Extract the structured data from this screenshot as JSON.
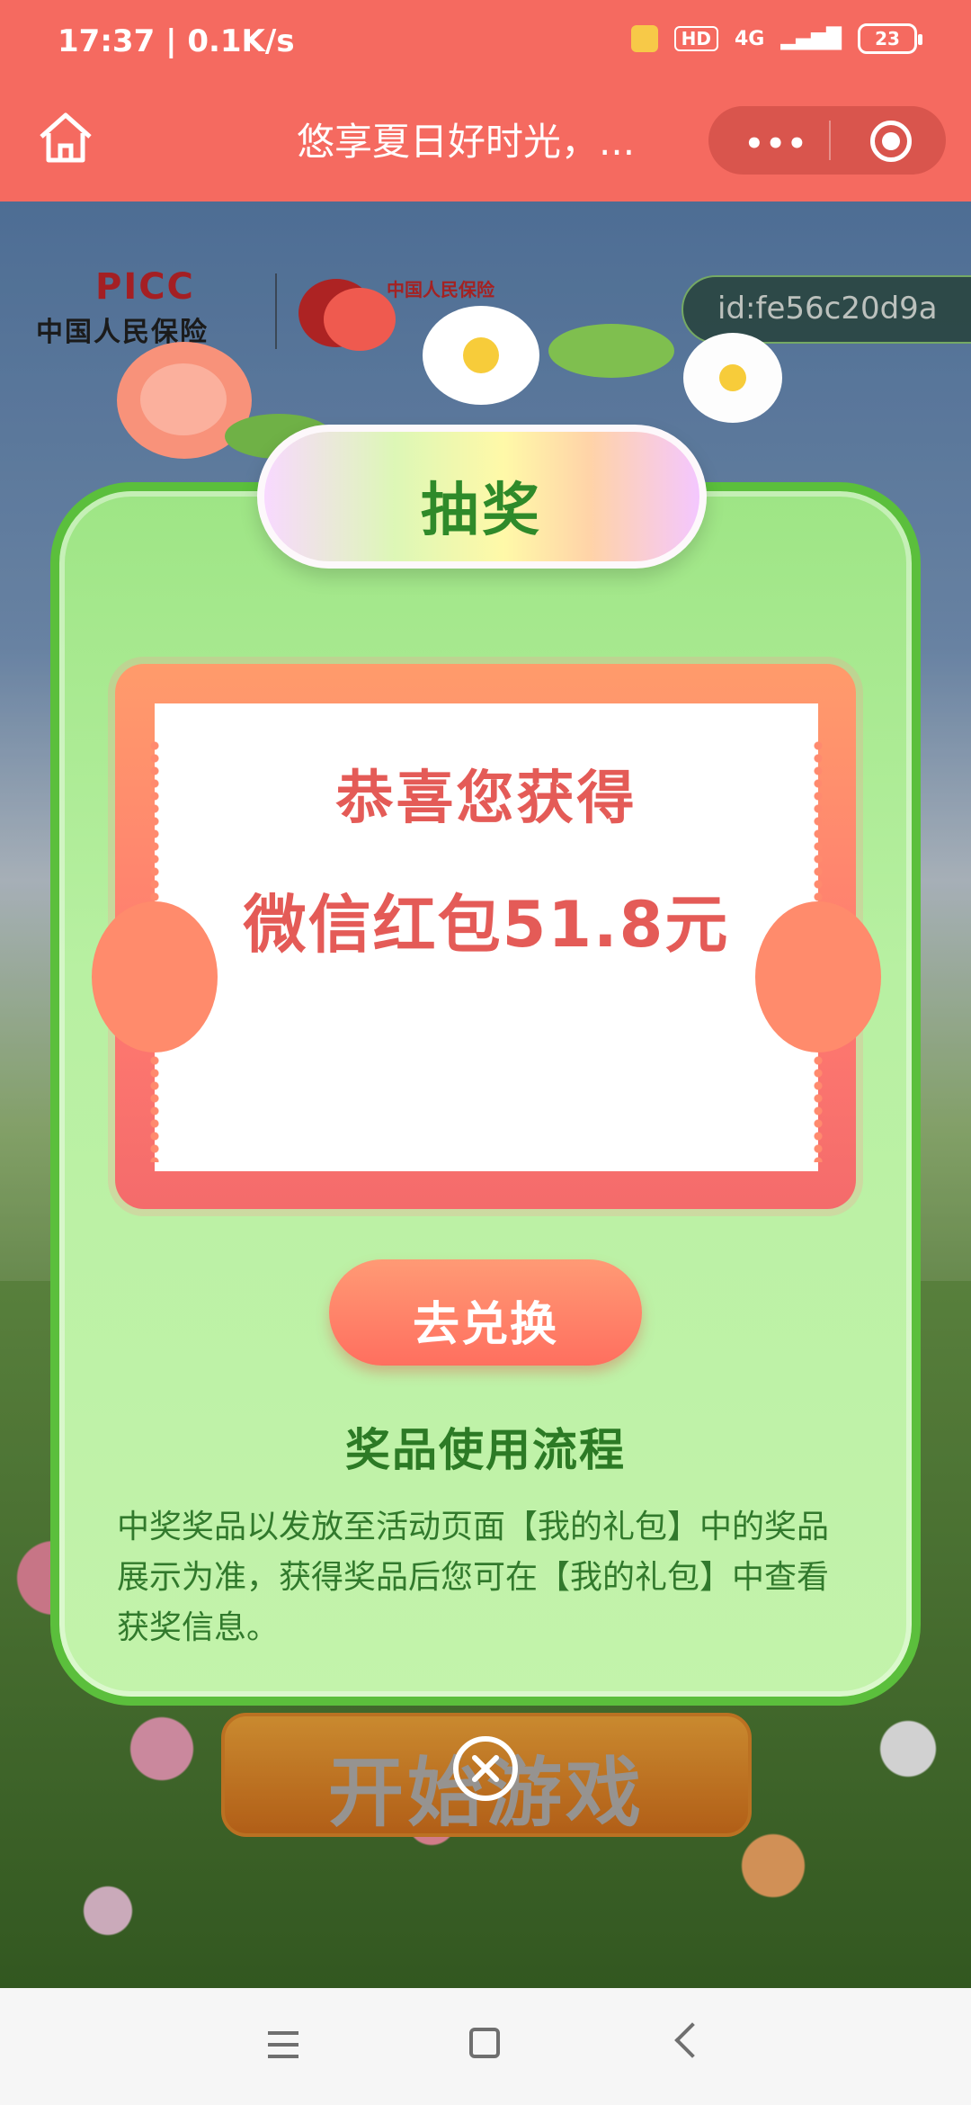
{
  "status_bar": {
    "time": "17:37 | 0.1K/s",
    "hd": "HD",
    "network": "4G",
    "battery": "23"
  },
  "nav": {
    "title": "悠享夏日好时光，..."
  },
  "page": {
    "brand_en": "PICC",
    "brand_cn": "中国人民保险",
    "partner_text": "中国人民保险",
    "user_id": "id:fe56c20d9a",
    "start_button": "开始游戏"
  },
  "modal": {
    "header": "抽奖",
    "congrats": "恭喜您获得",
    "prize": "微信红包51.8元",
    "redeem_button": "去兑换",
    "process_title": "奖品使用流程",
    "process_desc": "中奖奖品以发放至活动页面【我的礼包】中的奖品展示为准，获得奖品后您可在【我的礼包】中查看获奖信息。"
  },
  "colors": {
    "header_bg": "#f56a60",
    "card_bg": "#b8f0a2",
    "card_border": "#5bbf3c",
    "ticket": "#ff7a70",
    "text_red": "#e45b57",
    "text_green": "#2c7a25"
  }
}
